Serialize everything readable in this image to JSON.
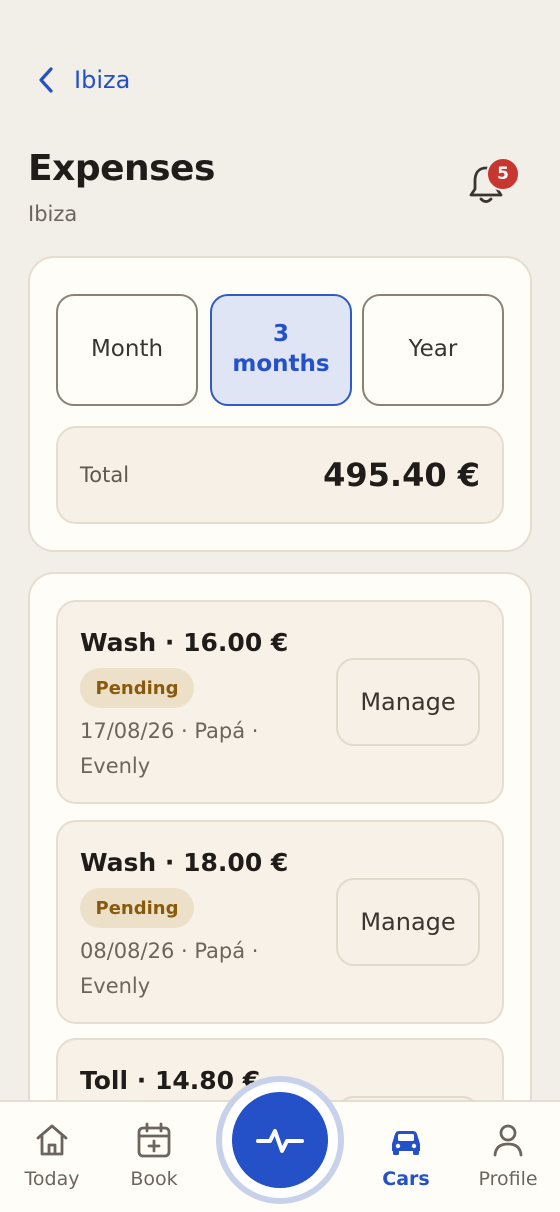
{
  "header": {
    "back_label": "Ibiza",
    "title": "Expenses",
    "subtitle": "Ibiza",
    "notification_count": "5"
  },
  "summary": {
    "ranges": [
      "Month",
      "3 months",
      "Year"
    ],
    "selected_range": "3 months",
    "total_label": "Total",
    "total_value": "495.40 €"
  },
  "expenses": [
    {
      "title": "Wash · 16.00 €",
      "status": "Pending",
      "meta": "17/08/26 · Papá · Evenly",
      "action": "Manage"
    },
    {
      "title": "Wash · 18.00 €",
      "status": "Pending",
      "meta": "08/08/26 · Papá · Evenly",
      "action": "Manage"
    },
    {
      "title": "Toll · 14.80 €",
      "status": "",
      "meta": "",
      "action": ""
    }
  ],
  "nav": {
    "items": [
      {
        "label": "Today",
        "icon": "home-icon"
      },
      {
        "label": "Book",
        "icon": "calendar-plus-icon"
      },
      {
        "label": "Cars",
        "icon": "car-icon",
        "active": true
      },
      {
        "label": "Profile",
        "icon": "person-icon"
      }
    ],
    "fab_icon": "activity-pulse-icon"
  },
  "colors": {
    "accent": "#2450c8",
    "background": "#f2eee8",
    "card": "#fffdf8",
    "badge": "#c7362f",
    "pending_text": "#8a5a0c",
    "pending_bg": "#ece0c8"
  }
}
